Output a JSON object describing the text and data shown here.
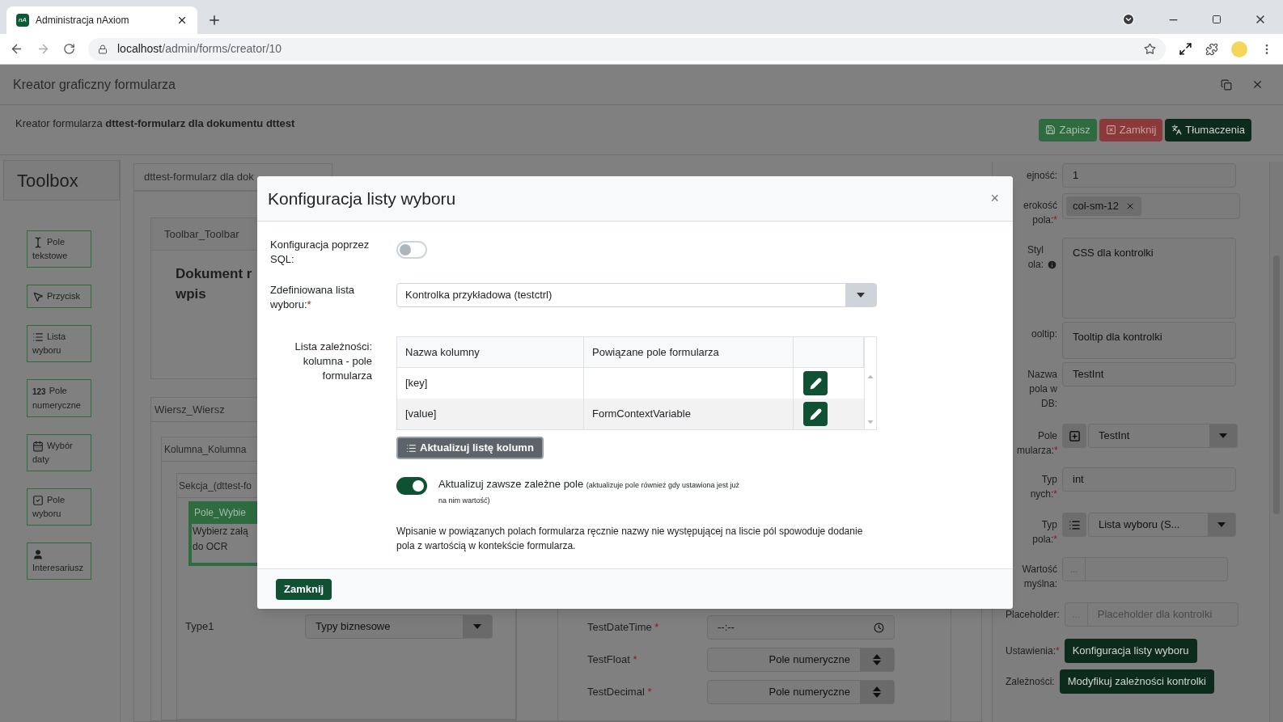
{
  "browser": {
    "tab_title": "Administracja nAxiom",
    "favicon": "nA",
    "url_host": "localhost",
    "url_path": "/admin/forms/creator/10"
  },
  "app": {
    "title": "Kreator graficzny formularza",
    "header": "Kreator formularza **dttest-formularz dla dokumentu dttest**",
    "actions": [
      {
        "label": "Zapisz",
        "kind": "save"
      },
      {
        "label": "Zamknij",
        "kind": "close"
      },
      {
        "label": "Tłumaczenia",
        "kind": "translate"
      }
    ]
  },
  "toolbox": {
    "title": "Toolbox",
    "items": [
      {
        "label": "Pole tekstowe",
        "kind": "text"
      },
      {
        "label": "Przycisk",
        "kind": "button"
      },
      {
        "label": "Lista wyboru",
        "kind": "list"
      },
      {
        "label": "Pole numeryczne",
        "kind": "number",
        "icon_text": "123"
      },
      {
        "label": "Wybór daty",
        "kind": "date"
      },
      {
        "label": "Pole wyboru",
        "kind": "checkbox"
      },
      {
        "label": "Interesariusz",
        "kind": "person"
      }
    ]
  },
  "canvas": {
    "tab": "dttest-formularz dla dok",
    "toolbar_panel": "Toolbar_Toolbar",
    "heading_lines": [
      "Dokument r",
      "wpis"
    ],
    "row_panel": "Wiersz_Wiersz",
    "column_panel": "Kolumna_Kolumna",
    "section_panel": "Sekcja_(dttest-fo",
    "field_title": "Pole_Wybie",
    "field_text_lines": [
      "Wybierz załą",
      "do OCR"
    ],
    "left_fields": [
      {
        "label": "Type1",
        "kind": "select",
        "placeholder": "Typy biznesowe"
      }
    ],
    "right_fields": [
      {
        "label": "TestDateTime",
        "required": "*",
        "kind": "time",
        "value": "--:--"
      },
      {
        "label": "TestFloat",
        "required": "*",
        "kind": "number",
        "placeholder": "Pole numeryczne"
      },
      {
        "label": "TestDecimal",
        "required": "*",
        "kind": "number",
        "placeholder": "Pole numeryczne"
      }
    ]
  },
  "properties": [
    {
      "label": "ejność:",
      "kind": "input",
      "value": "1"
    },
    {
      "label": "erokość pola:",
      "required": "*",
      "kind": "tags",
      "value": "col-sm-12"
    },
    {
      "label": "Styl ola:",
      "kind": "textarea",
      "placeholder": "CSS dla kontrolki",
      "info": true
    },
    {
      "label": "ooltip:",
      "kind": "textarea",
      "placeholder": "Tooltip dla kontrolki"
    },
    {
      "label": "Nazwa pola w DB:",
      "kind": "input",
      "value": "TestInt"
    },
    {
      "label": "Pole mularza:",
      "required": "*",
      "kind": "select-add",
      "value": "TestInt"
    },
    {
      "label": "Typ nych:",
      "required": "*",
      "kind": "input",
      "value": "int"
    },
    {
      "label": "Typ pola:",
      "required": "*",
      "kind": "select-list",
      "value": "Lista wyboru (S..."
    },
    {
      "label": "Wartość myślna:",
      "kind": "addon",
      "addon": "..."
    },
    {
      "label": "Placeholder:",
      "kind": "addon",
      "addon": "...",
      "placeholder": "Placeholder dla kontrolki"
    },
    {
      "label": "Ustawienia:",
      "required": "*",
      "kind": "button",
      "button": "Konfiguracja listy wyboru"
    },
    {
      "label": "Zależności:",
      "kind": "button",
      "button": "Modyfikuj zależności kontrolki"
    }
  ],
  "modal": {
    "title": "Konfiguracja listy wyboru",
    "close": "×",
    "sql": {
      "label": "Konfiguracja poprzez SQL:",
      "on": false
    },
    "list": {
      "label": "Zdefiniowana lista wyboru:",
      "required": "*",
      "value": "Kontrolka przykładowa (testctrl)"
    },
    "dependencies": {
      "label": "Lista zależności: kolumna - pole formularza",
      "columns": [
        "Nazwa kolumny",
        "Powiązane pole formularza"
      ],
      "rows": [
        {
          "column": "[key]"
        },
        {
          "column": "[value]",
          "field": "FormContextVariable"
        }
      ]
    },
    "refresh_button": "Aktualizuj listę kolumn",
    "always_update": {
      "on": true,
      "label": "Aktualizuj zawsze zależne pole",
      "note": "(aktualizuje pole również gdy ustawiona jest już na nim wartość)"
    },
    "info": "Wpisanie w powiązanych polach formularza ręcznie nazwy nie występującej na liscie pól spowoduje dodanie pola z wartością w kontekście formularza.",
    "footer_button": "Zamknij"
  }
}
